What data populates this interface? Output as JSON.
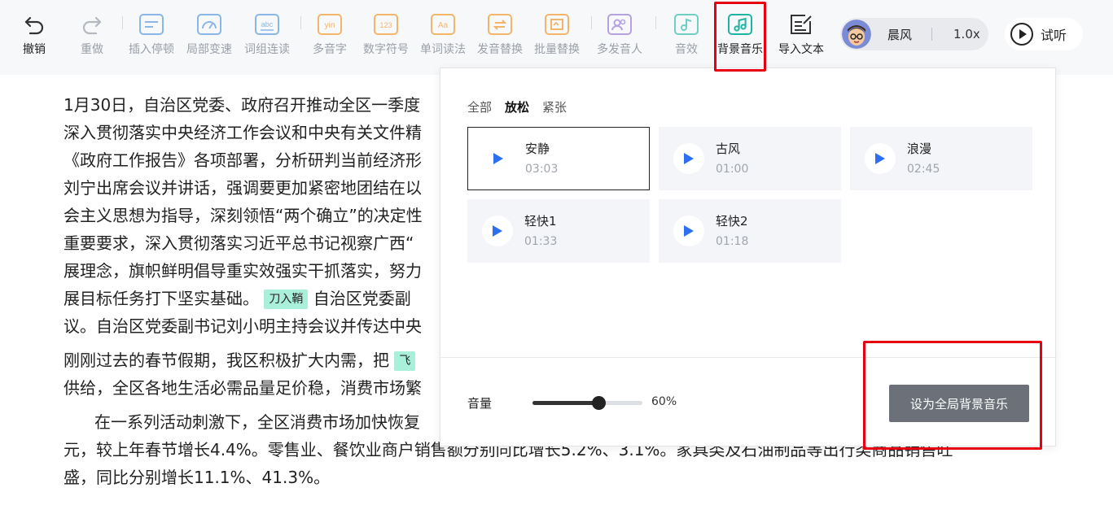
{
  "toolbar": {
    "undo": "撤销",
    "redo": "重做",
    "insert_pause": "插入停顿",
    "local_speed": "局部变速",
    "word_group": "词组连读",
    "polyphone": "多音字",
    "number_symbol": "数字符号",
    "word_reading": "单词读法",
    "pronunciation_replace": "发音替换",
    "batch_replace": "批量替换",
    "multi_speaker": "多发音人",
    "sound_effect": "音效",
    "bg_music": "背景音乐",
    "import_text": "导入文本",
    "icons": {
      "insert_pause": "abc",
      "polyphone": "yin",
      "number_symbol": "123",
      "word_reading": "Aa",
      "word_group": "abc"
    }
  },
  "voice": {
    "name": "晨风",
    "speed": "1.0x"
  },
  "try_listen": "试听",
  "document": {
    "lines": [
      "1月30日，自治区党委、政府召开推动全区一季度",
      "深入贯彻落实中央经济工作会议和中央有关文件精",
      "《政府工作报告》各项部署，分析研判当前经济形",
      "刘宁出席会议并讲话，强调要更加紧密地团结在以",
      "会主义思想为指导，深刻领悟“两个确立”的决定性",
      "重要要求，深入贯彻落实习近平总书记视察广西“",
      "展理念，旗帜鲜明倡导重实效强实干抓落实，努力",
      "展目标任务打下坚实基础。",
      "议。自治区党委副书记刘小明主持会议并传达中央",
      "刚刚过去的春节假期，我区积极扩大内需，把",
      "供给，全区各地生活必需品量足价稳，消费市场繁",
      "在一系列活动刺激下，全区消费市场加快恢复",
      "元，较上年春节增长4.4%。零售业、餐饮业商户销售额分别同比增长5.2%、3.1%。家具类及石油制品等出行类商品销售旺",
      "盛，同比分别增长11.1%、41.3%。"
    ],
    "line8_rest": "自治区党委副",
    "tag1": "刀入鞘",
    "tag2": "飞"
  },
  "music_panel": {
    "tabs": [
      "全部",
      "放松",
      "紧张"
    ],
    "active_tab": 1,
    "tracks": [
      {
        "name": "安静",
        "duration": "03:03",
        "selected": true
      },
      {
        "name": "古风",
        "duration": "01:00",
        "selected": false
      },
      {
        "name": "浪漫",
        "duration": "02:45",
        "selected": false
      },
      {
        "name": "轻快1",
        "duration": "01:33",
        "selected": false
      },
      {
        "name": "轻快2",
        "duration": "01:18",
        "selected": false
      }
    ],
    "volume_label": "音量",
    "volume_value": "60%",
    "volume_fraction": 0.6,
    "set_global_button": "设为全局背景音乐"
  },
  "colors": {
    "accent_teal": "#1fb3a4",
    "icon_blue": "#8ab6e8",
    "icon_orange": "#f3b56b",
    "icon_purple": "#b7a2e0",
    "play_blue": "#2c6ff0",
    "highlight_red": "#e60012"
  }
}
